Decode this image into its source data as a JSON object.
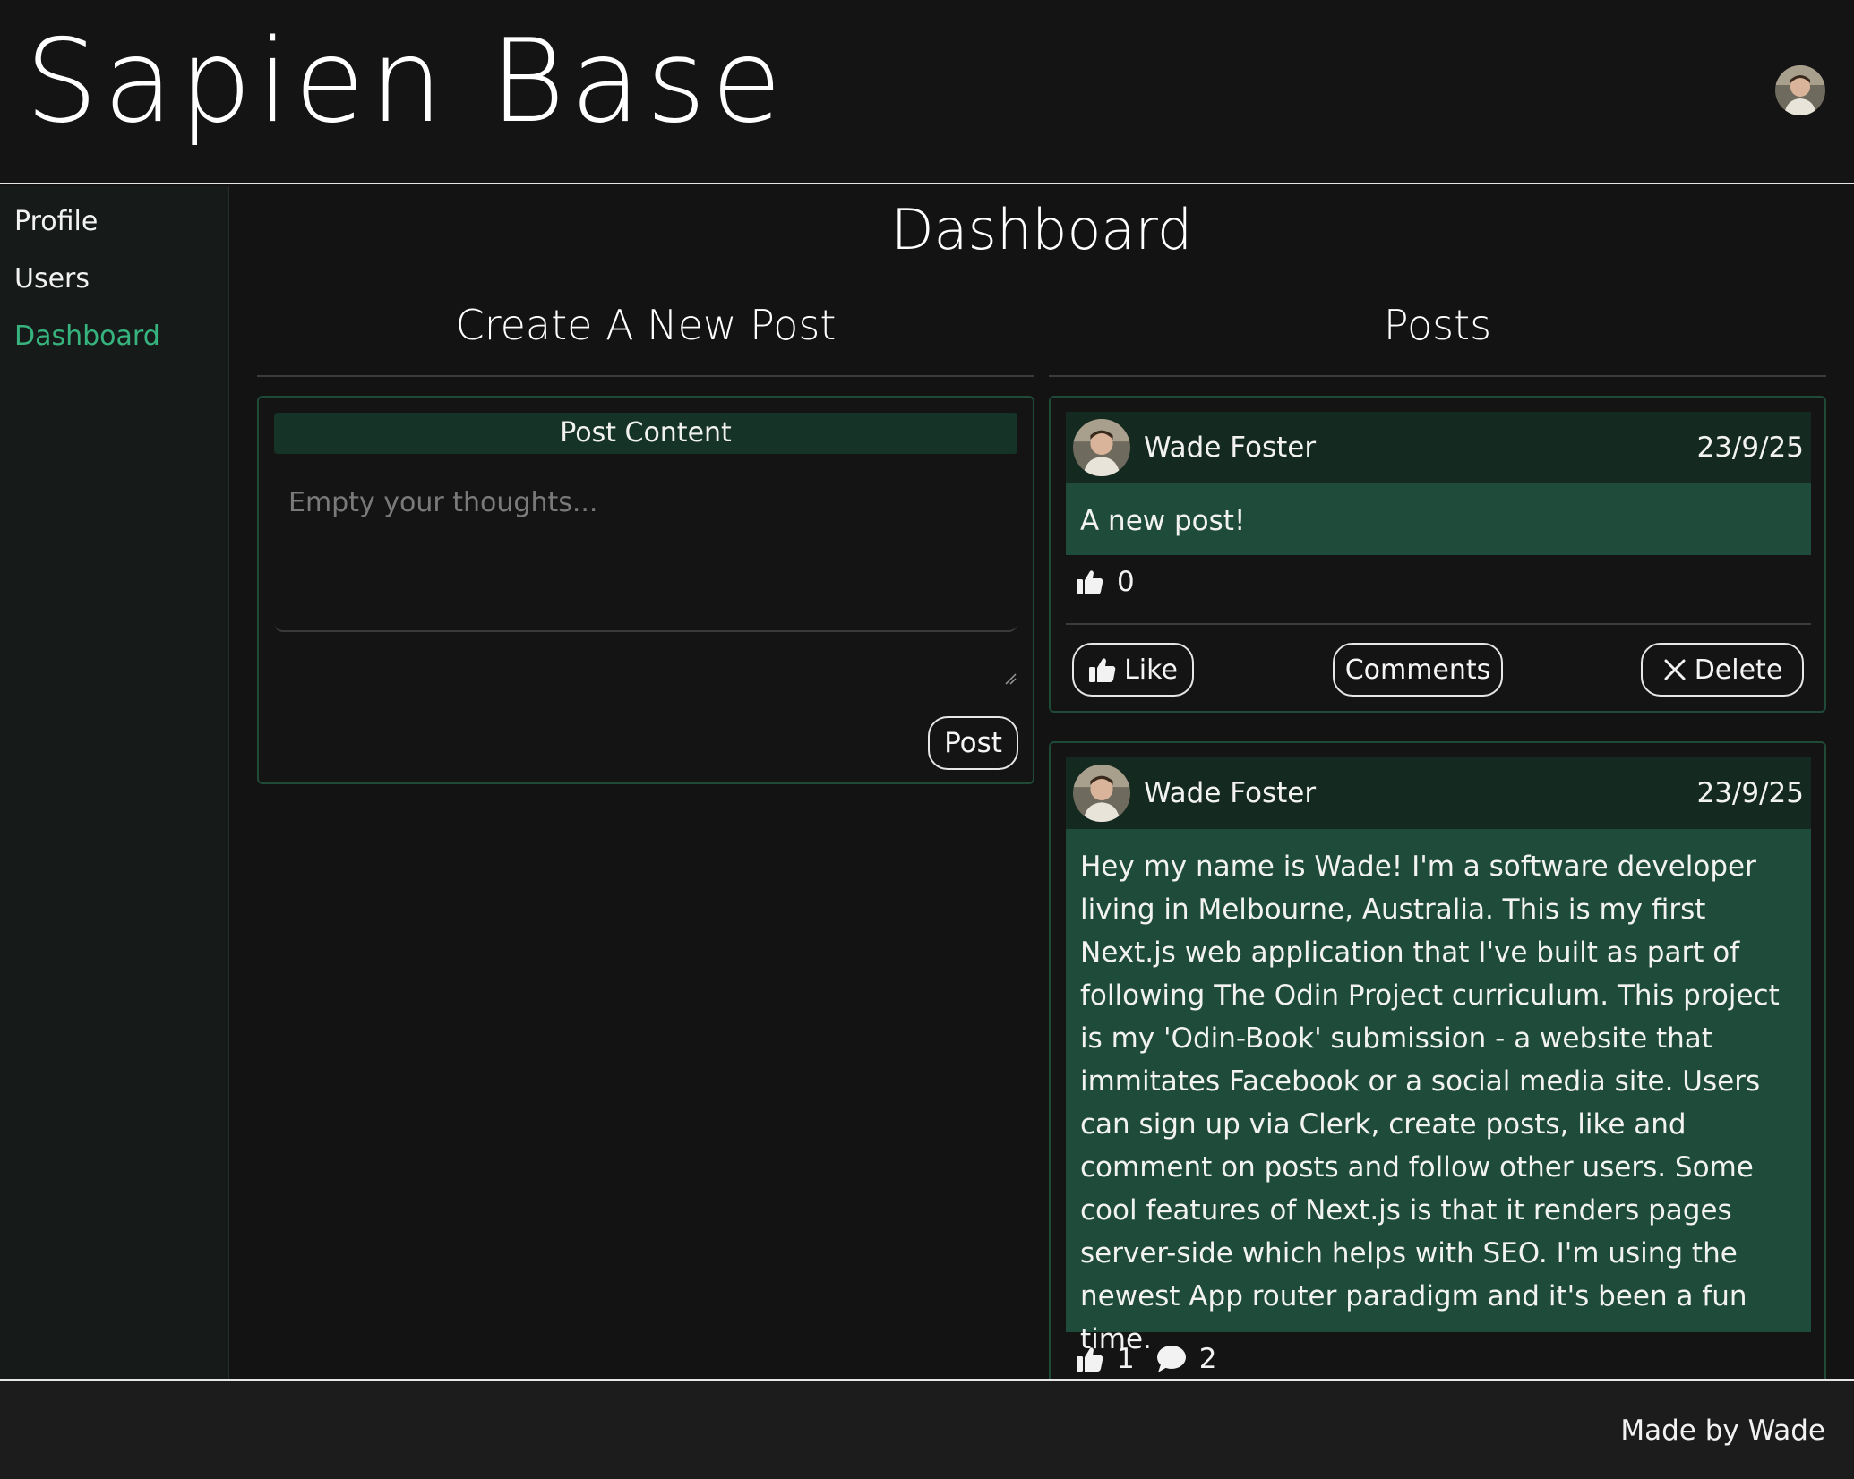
{
  "header": {
    "site_title": "Sapien Base",
    "avatar_icon": "user-avatar"
  },
  "sidebar": {
    "items": [
      {
        "label": "Profile",
        "active": false
      },
      {
        "label": "Users",
        "active": false
      },
      {
        "label": "Dashboard",
        "active": true
      }
    ]
  },
  "main": {
    "page_title": "Dashboard",
    "create_post": {
      "heading": "Create A New Post",
      "content_label": "Post Content",
      "placeholder": "Empty your thoughts...",
      "value": "",
      "submit_label": "Post"
    },
    "posts_heading": "Posts",
    "posts": [
      {
        "author": "Wade Foster",
        "date": "23/9/25",
        "content": "A new post!",
        "likes": "0",
        "actions": {
          "like_label": "Like",
          "comments_label": "Comments",
          "delete_label": "Delete"
        }
      },
      {
        "author": "Wade Foster",
        "date": "23/9/25",
        "content": "Hey my name is Wade! I'm a software developer living in Melbourne, Australia. This is my first Next.js web application that I've built as part of following The Odin Project curriculum. This project is my 'Odin-Book' submission - a website that immitates Facebook or a social media site. Users can sign up via Clerk, create posts, like and comment on posts and follow other users. Some cool features of Next.js is that it renders pages server-side which helps with SEO. I'm using the newest App router paradigm and it's been a fun time.",
        "likes": "1",
        "comments": "2"
      }
    ]
  },
  "footer": {
    "text": "Made by Wade"
  },
  "colors": {
    "background": "#131313",
    "accent": "#36b37e",
    "card_border": "#1f4a38",
    "post_header": "#14291f",
    "post_body": "#1f4c3a"
  }
}
